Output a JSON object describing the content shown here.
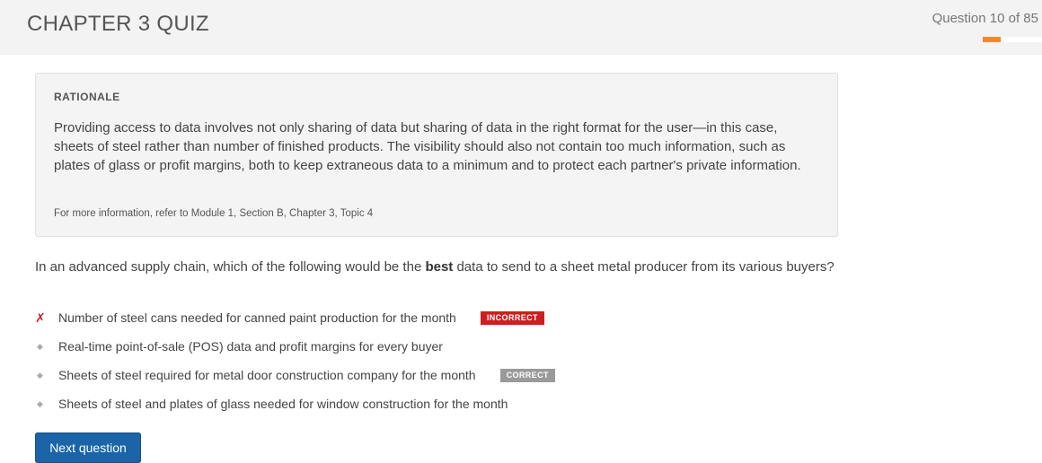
{
  "header": {
    "title": "CHAPTER 3 QUIZ",
    "question_counter": "Question 10 of 85",
    "progress_fraction": 0.3,
    "progress_color": "#ee8a2e"
  },
  "rationale": {
    "heading": "RATIONALE",
    "body": "Providing access to data involves not only sharing of data but sharing of data in the right format for the user—in this case, sheets of steel rather than number of finished products. The visibility should also not contain too much information, such as plates of glass or profit margins, both to keep extraneous data to a minimum and to protect each partner's private information.",
    "reference": "For more information, refer to Module 1, Section B, Chapter 3, Topic 4"
  },
  "question": {
    "text_before": "In an advanced supply chain, which of the following would be the ",
    "emphasis": "best",
    "text_after": " data to send to a sheet metal producer from its various buyers?"
  },
  "options": [
    {
      "text": "Number of steel cans needed for canned paint production for the month",
      "status": "incorrect",
      "badge": "INCORRECT",
      "marker": "wrong-x-icon"
    },
    {
      "text": "Real-time point-of-sale (POS) data and profit margins for every buyer",
      "status": "none",
      "badge": "",
      "marker": "diamond-bullet-icon"
    },
    {
      "text": "Sheets of steel required for metal door construction company for the month",
      "status": "correct",
      "badge": "CORRECT",
      "marker": "diamond-bullet-icon"
    },
    {
      "text": "Sheets of steel and plates of glass needed for window construction for the month",
      "status": "none",
      "badge": "",
      "marker": "diamond-bullet-icon"
    }
  ],
  "actions": {
    "next_label": "Next question",
    "next_color": "#1a64a7"
  },
  "colors": {
    "incorrect": "#cc1f1f",
    "correct_badge": "#9a9a9a",
    "header_bg": "#f3f3f3"
  }
}
